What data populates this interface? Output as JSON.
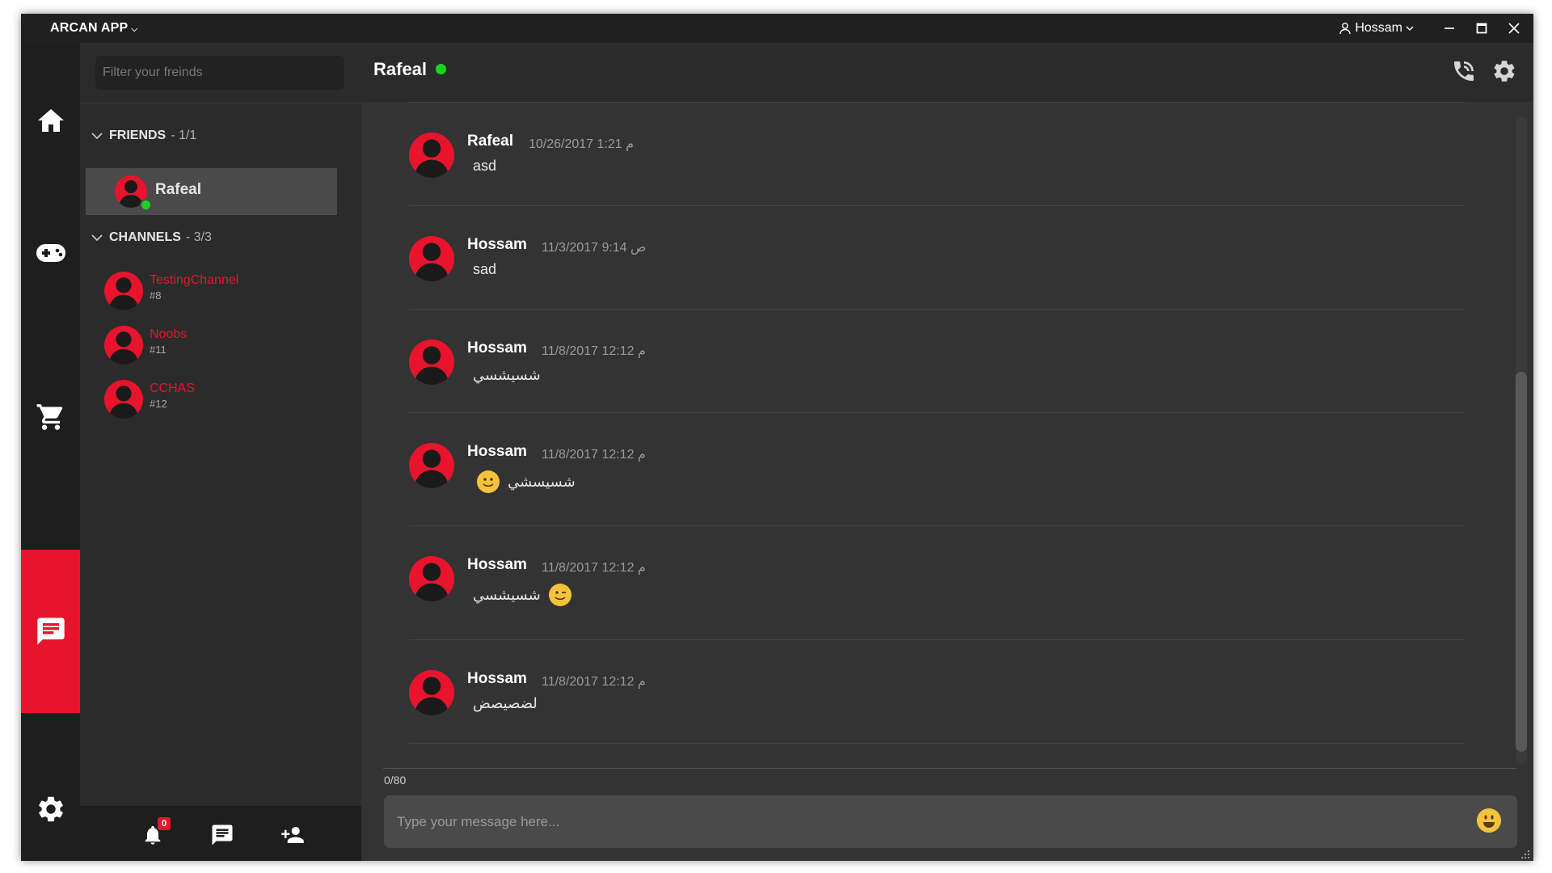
{
  "titlebar": {
    "app_title": "ARCAN APP",
    "user_name": "Hossam"
  },
  "sidebar": {
    "filter_placeholder": "Filter your freinds",
    "friends_section": {
      "title": "FRIENDS",
      "count": "- 1/1"
    },
    "friends": [
      {
        "name": "Rafeal",
        "status": "online"
      }
    ],
    "channels_section": {
      "title": "CHANNELS",
      "count": "- 3/3"
    },
    "channels": [
      {
        "name": "TestingChannel",
        "id": "#8"
      },
      {
        "name": "Noobs",
        "id": "#11"
      },
      {
        "name": "CCHAS",
        "id": "#12"
      }
    ],
    "notification_count": "0"
  },
  "chat": {
    "title": "Rafeal",
    "status_color": "#1ed31e",
    "messages": [
      {
        "author": "Rafeal",
        "time": "10/26/2017 1:21 م",
        "text": "asd",
        "emoji": ""
      },
      {
        "author": "Hossam",
        "time": "11/3/2017 9:14 ص",
        "text": "sad",
        "emoji": ""
      },
      {
        "author": "Hossam",
        "time": "11/8/2017 12:12 م",
        "text": "شسيشسي",
        "emoji": ""
      },
      {
        "author": "Hossam",
        "time": "11/8/2017 12:12 م",
        "text": "شسيسشي",
        "emoji": "smile-emoji"
      },
      {
        "author": "Hossam",
        "time": "11/8/2017 12:12 م",
        "text": "شسيشسي",
        "emoji": "wink-emoji"
      },
      {
        "author": "Hossam",
        "time": "11/8/2017 12:12 م",
        "text": "لضصيصض",
        "emoji": ""
      }
    ],
    "char_count": "0/80",
    "input_placeholder": "Type your message here..."
  },
  "colors": {
    "accent": "#e8142d",
    "online": "#1ed31e",
    "background": "#333333"
  }
}
